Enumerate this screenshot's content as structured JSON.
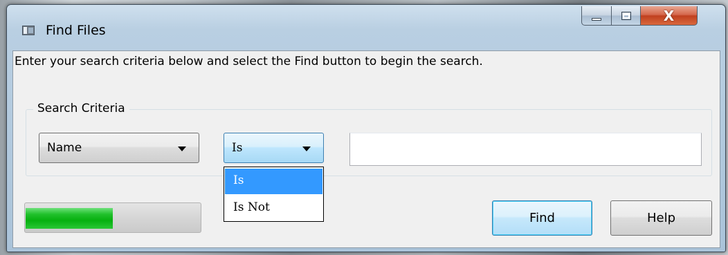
{
  "window": {
    "title": "Find Files",
    "app_icon": "app-window-icon",
    "controls": {
      "minimize_icon": "minimize-icon",
      "maximize_icon": "maximize-icon",
      "close_icon": "close-icon",
      "close_glyph": "X"
    }
  },
  "instructions": "Enter your search criteria below and select the Find button to begin the search.",
  "criteria": {
    "group_label": "Search Criteria",
    "field_combo": {
      "value": "Name"
    },
    "operator_combo": {
      "value": "Is",
      "options": [
        {
          "label": "Is",
          "selected": true
        },
        {
          "label": "Is Not",
          "selected": false
        }
      ]
    },
    "value_input": {
      "value": "",
      "placeholder": ""
    }
  },
  "progress": {
    "fraction": 0.5,
    "color": "#06b00f"
  },
  "buttons": {
    "find_label": "Find",
    "help_label": "Help"
  },
  "colors": {
    "selection": "#3399ff",
    "focus_border": "#3c7fb1",
    "close_button": "#c0401f"
  }
}
